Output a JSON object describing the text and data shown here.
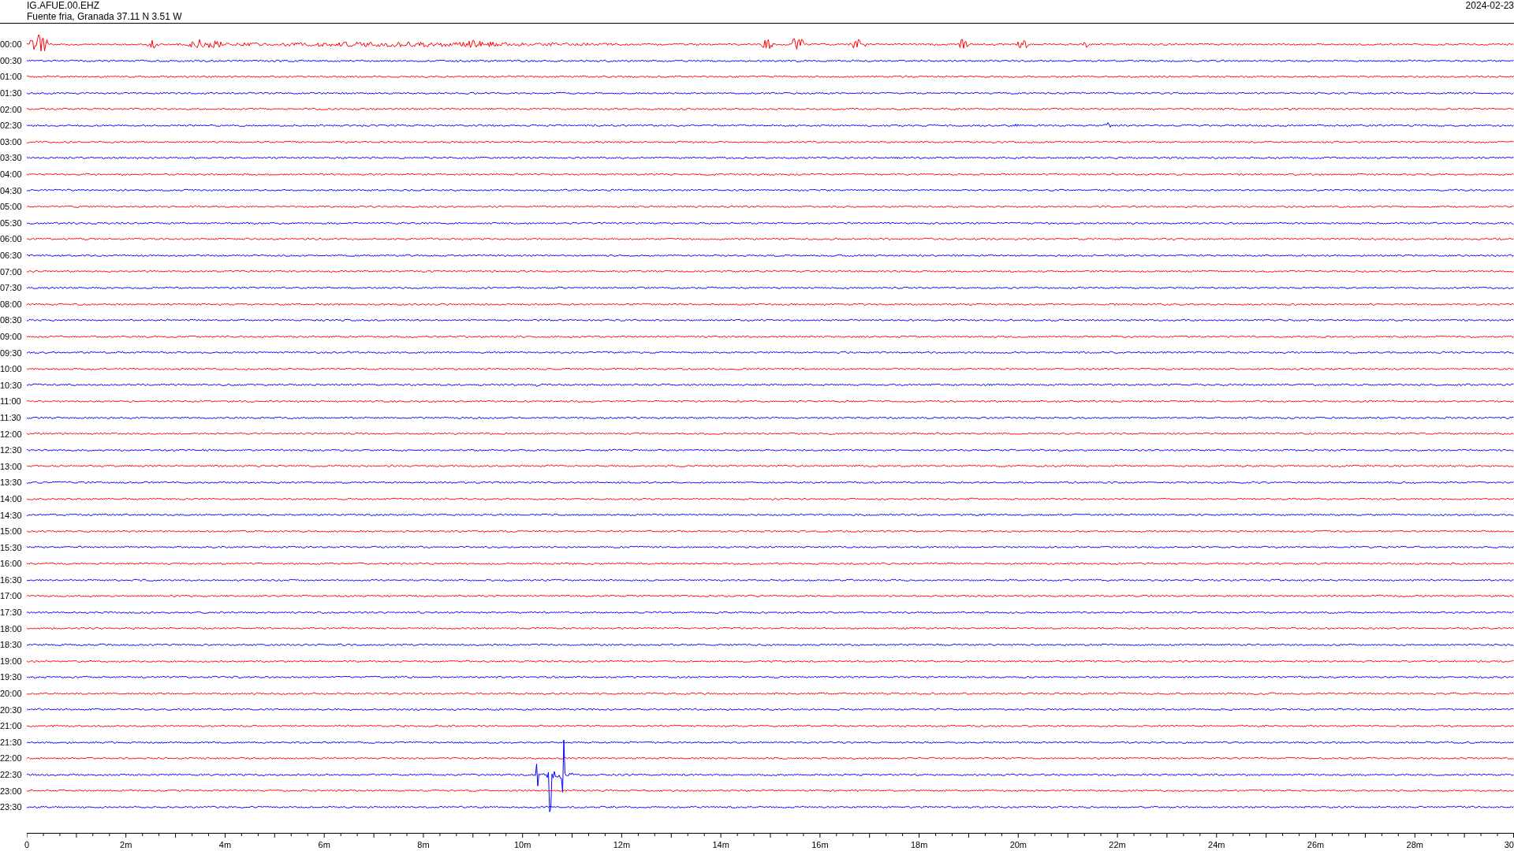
{
  "header": {
    "station": "IG.AFUE.00.EHZ",
    "location": "Fuente fria, Granada  37.11 N 3.51 W",
    "date": "2024-02-23"
  },
  "rows": [
    {
      "time": "00:00",
      "color": "#ff0000"
    },
    {
      "time": "00:30",
      "color": "#0000ff"
    },
    {
      "time": "01:00",
      "color": "#ff0000"
    },
    {
      "time": "01:30",
      "color": "#0000ff"
    },
    {
      "time": "02:00",
      "color": "#ff0000"
    },
    {
      "time": "02:30",
      "color": "#0000ff"
    },
    {
      "time": "03:00",
      "color": "#ff0000"
    },
    {
      "time": "03:30",
      "color": "#0000ff"
    },
    {
      "time": "04:00",
      "color": "#ff0000"
    },
    {
      "time": "04:30",
      "color": "#0000ff"
    },
    {
      "time": "05:00",
      "color": "#ff0000"
    },
    {
      "time": "05:30",
      "color": "#0000ff"
    },
    {
      "time": "06:00",
      "color": "#ff0000"
    },
    {
      "time": "06:30",
      "color": "#0000ff"
    },
    {
      "time": "07:00",
      "color": "#ff0000"
    },
    {
      "time": "07:30",
      "color": "#0000ff"
    },
    {
      "time": "08:00",
      "color": "#ff0000"
    },
    {
      "time": "08:30",
      "color": "#0000ff"
    },
    {
      "time": "09:00",
      "color": "#ff0000"
    },
    {
      "time": "09:30",
      "color": "#0000ff"
    },
    {
      "time": "10:00",
      "color": "#ff0000"
    },
    {
      "time": "10:30",
      "color": "#0000ff"
    },
    {
      "time": "11:00",
      "color": "#ff0000"
    },
    {
      "time": "11:30",
      "color": "#0000ff"
    },
    {
      "time": "12:00",
      "color": "#ff0000"
    },
    {
      "time": "12:30",
      "color": "#0000ff"
    },
    {
      "time": "13:00",
      "color": "#ff0000"
    },
    {
      "time": "13:30",
      "color": "#0000ff"
    },
    {
      "time": "14:00",
      "color": "#ff0000"
    },
    {
      "time": "14:30",
      "color": "#0000ff"
    },
    {
      "time": "15:00",
      "color": "#ff0000"
    },
    {
      "time": "15:30",
      "color": "#0000ff"
    },
    {
      "time": "16:00",
      "color": "#ff0000"
    },
    {
      "time": "16:30",
      "color": "#0000ff"
    },
    {
      "time": "17:00",
      "color": "#ff0000"
    },
    {
      "time": "17:30",
      "color": "#0000ff"
    },
    {
      "time": "18:00",
      "color": "#ff0000"
    },
    {
      "time": "18:30",
      "color": "#0000ff"
    },
    {
      "time": "19:00",
      "color": "#ff0000"
    },
    {
      "time": "19:30",
      "color": "#0000ff"
    },
    {
      "time": "20:00",
      "color": "#ff0000"
    },
    {
      "time": "20:30",
      "color": "#0000ff"
    },
    {
      "time": "21:00",
      "color": "#ff0000"
    },
    {
      "time": "21:30",
      "color": "#0000ff"
    },
    {
      "time": "22:00",
      "color": "#ff0000"
    },
    {
      "time": "22:30",
      "color": "#0000ff"
    },
    {
      "time": "23:00",
      "color": "#ff0000"
    },
    {
      "time": "23:30",
      "color": "#0000ff"
    }
  ],
  "axis_labels": [
    "0",
    "2m",
    "4m",
    "6m",
    "8m",
    "10m",
    "12m",
    "14m",
    "16m",
    "18m",
    "20m",
    "22m",
    "24m",
    "26m",
    "28m",
    "30"
  ]
}
